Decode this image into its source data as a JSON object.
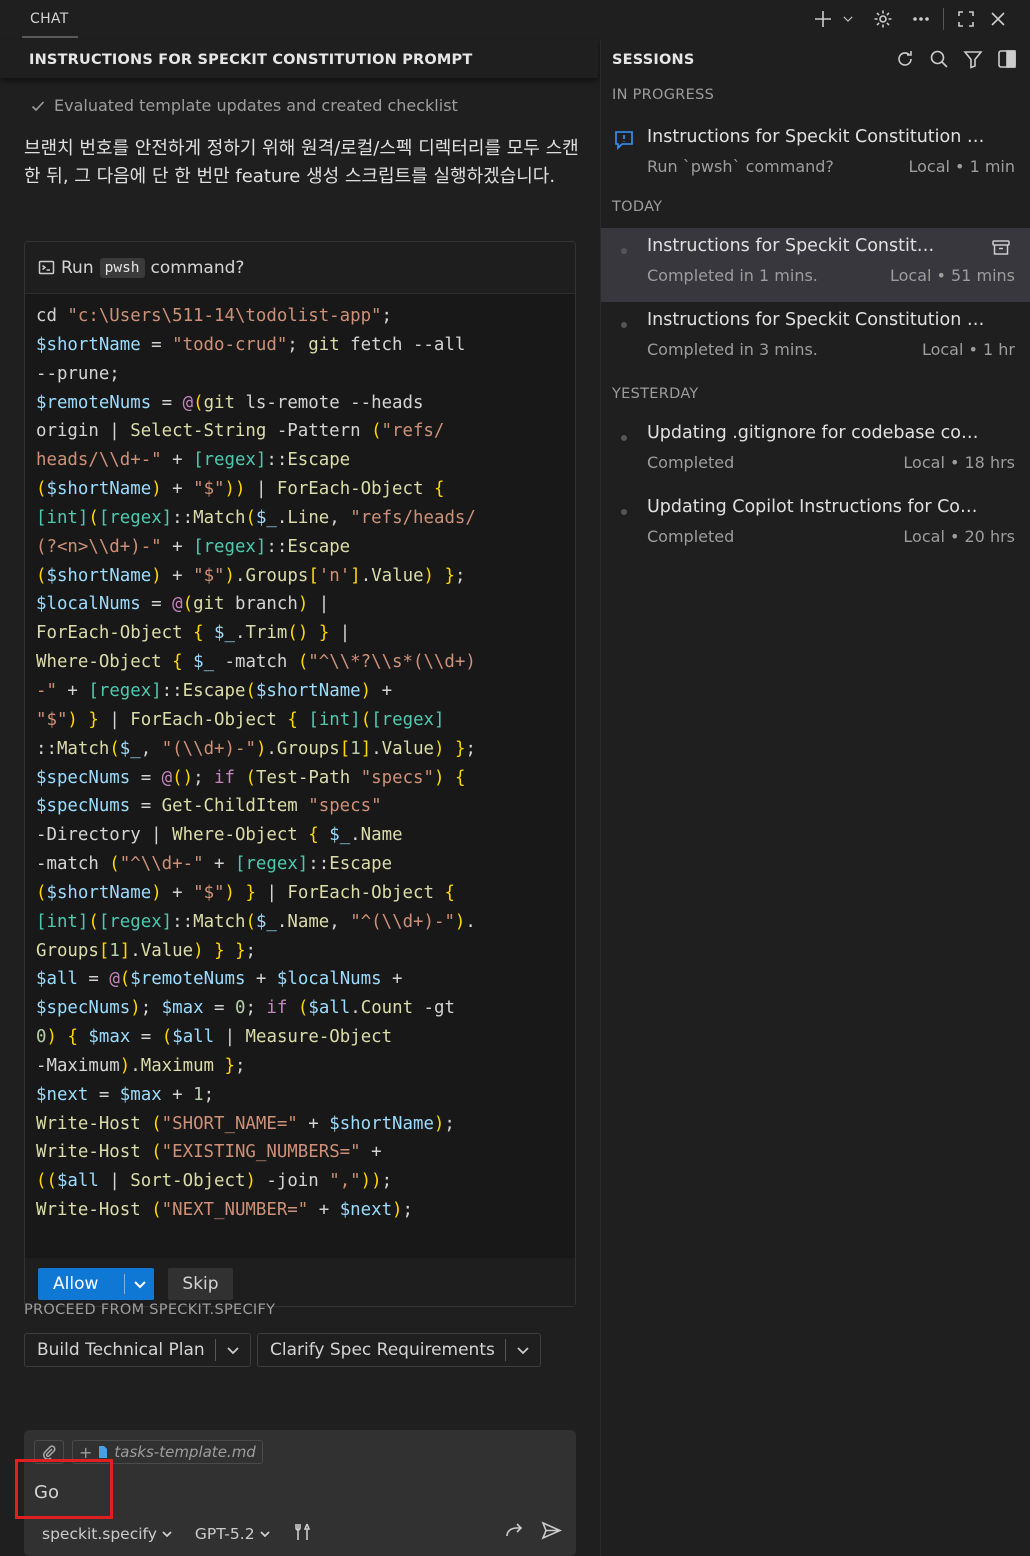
{
  "topbar": {
    "tab_label": "CHAT",
    "icons": [
      "plus-icon",
      "chevron-down-icon",
      "gear-icon",
      "more-icon",
      "maximize-icon",
      "close-icon"
    ]
  },
  "chat": {
    "title": "INSTRUCTIONS FOR SPECKIT CONSTITUTION PROMPT",
    "evaluated": "Evaluated template updates and created checklist",
    "message": "브랜치 번호를 안전하게 정하기 위해 원격/로컬/스펙 디렉터리를 모두 스캔한 뒤, 그 다음에 단 한 번만 feature 생성 스크립트를 실행하겠습니다.",
    "run_prefix": "Run",
    "run_cmd": "pwsh",
    "run_suffix": "command?",
    "allow_label": "Allow",
    "skip_label": "Skip",
    "proceed_label": "PROCEED FROM SPECKIT.SPECIFY",
    "proceed_buttons": [
      "Build Technical Plan",
      "Clarify Spec Requirements"
    ],
    "context_file": "tasks-template.md",
    "input_value": "Go",
    "agent_mode": "speckit.specify",
    "model": "GPT-5.2"
  },
  "sessions": {
    "title": "SESSIONS",
    "in_progress_label": "IN PROGRESS",
    "today_label": "TODAY",
    "yesterday_label": "YESTERDAY",
    "in_progress": [
      {
        "name": "Instructions for Speckit Constitution Prompt",
        "sub": "Run `pwsh` command?",
        "meta": "Local • 1 min"
      }
    ],
    "today": [
      {
        "name": "Instructions for Speckit Constitution Pr...",
        "sub": "Completed in 1 mins.",
        "meta": "Local • 51 mins"
      },
      {
        "name": "Instructions for Speckit Constitution Prompt",
        "sub": "Completed in 3 mins.",
        "meta": "Local • 1 hr"
      }
    ],
    "yesterday": [
      {
        "name": "Updating .gitignore for codebase compati...",
        "sub": "Completed",
        "meta": "Local • 18 hrs"
      },
      {
        "name": "Updating Copilot Instructions for Codebas...",
        "sub": "Completed",
        "meta": "Local • 20 hrs"
      }
    ]
  },
  "colors": {
    "accent": "#0e78d4",
    "highlight": "#e02020",
    "session_icon": "#3794ff"
  }
}
